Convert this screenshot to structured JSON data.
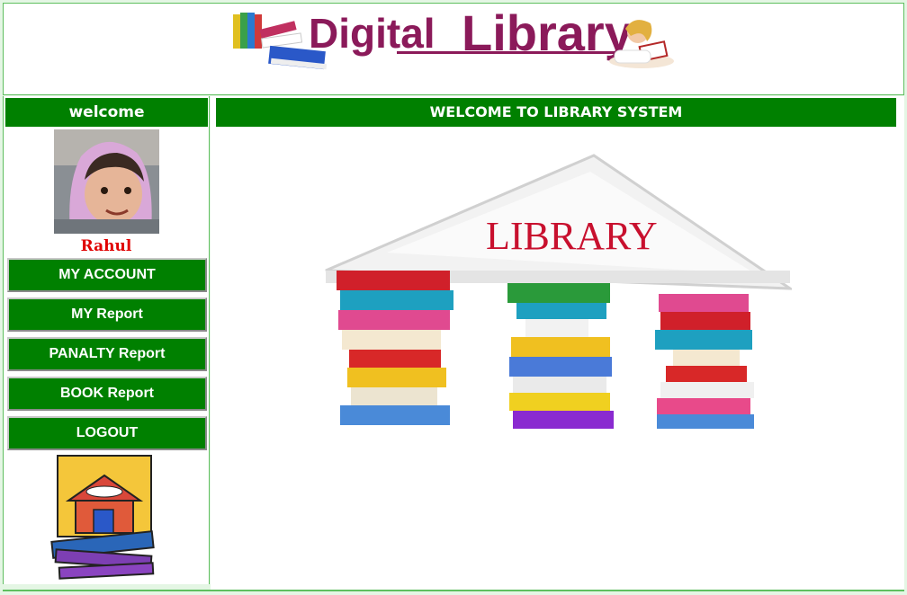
{
  "header": {
    "logo_part1": "Digital",
    "logo_part2": "Library"
  },
  "sidebar": {
    "welcome_label": "welcome",
    "user_name": "Rahul",
    "nav": [
      {
        "label": "MY ACCOUNT"
      },
      {
        "label": "MY Report"
      },
      {
        "label": "PANALTY Report"
      },
      {
        "label": "BOOK Report"
      },
      {
        "label": "LOGOUT"
      }
    ]
  },
  "main": {
    "title": "WELCOME TO LIBRARY SYSTEM",
    "illustration_text": "LIBRARY"
  },
  "colors": {
    "accent_green": "#008000",
    "border_green": "#5fbf5f",
    "user_name_red": "#e00000",
    "logo_purple": "#8b1a5a",
    "logo_green": "#1e9a3c"
  }
}
